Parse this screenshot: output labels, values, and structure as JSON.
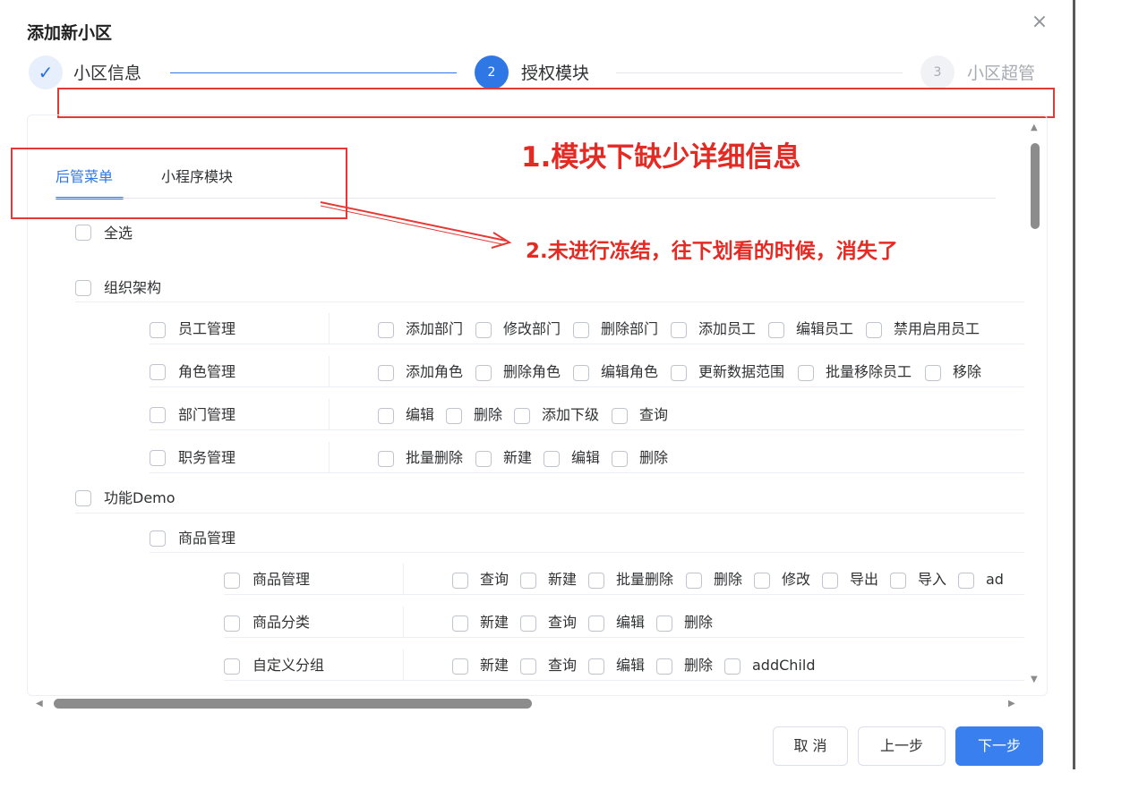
{
  "dialog": {
    "title": "添加新小区",
    "close_icon": "×"
  },
  "steps": [
    {
      "index": "✓",
      "label": "小区信息",
      "status": "finished"
    },
    {
      "index": "2",
      "label": "授权模块",
      "status": "active"
    },
    {
      "index": "3",
      "label": "小区超管",
      "status": "wait"
    }
  ],
  "annotations": {
    "note1": "1.模块下缺少详细信息",
    "note2": "2.未进行冻结，往下划看的时候，消失了"
  },
  "tabs": [
    {
      "label": "后管菜单",
      "active": true
    },
    {
      "label": "小程序模块",
      "active": false
    }
  ],
  "tree": {
    "select_all": "全选",
    "org": {
      "label": "组织架构",
      "rows": [
        {
          "name": "员工管理",
          "actions": [
            "添加部门",
            "修改部门",
            "删除部门",
            "添加员工",
            "编辑员工",
            "禁用启用员工"
          ]
        },
        {
          "name": "角色管理",
          "actions": [
            "添加角色",
            "删除角色",
            "编辑角色",
            "更新数据范围",
            "批量移除员工",
            "移除"
          ]
        },
        {
          "name": "部门管理",
          "actions": [
            "编辑",
            "删除",
            "添加下级",
            "查询"
          ]
        },
        {
          "name": "职务管理",
          "actions": [
            "批量删除",
            "新建",
            "编辑",
            "删除"
          ]
        }
      ]
    },
    "demo": {
      "label": "功能Demo",
      "sub": {
        "label": "商品管理",
        "rows": [
          {
            "name": "商品管理",
            "actions": [
              "查询",
              "新建",
              "批量删除",
              "删除",
              "修改",
              "导出",
              "导入",
              "ad"
            ]
          },
          {
            "name": "商品分类",
            "actions": [
              "新建",
              "查询",
              "编辑",
              "删除"
            ]
          },
          {
            "name": "自定义分组",
            "actions": [
              "新建",
              "查询",
              "编辑",
              "删除",
              "addChild"
            ]
          }
        ]
      }
    }
  },
  "buttons": {
    "cancel": "取 消",
    "prev": "上一步",
    "next": "下一步"
  },
  "colors": {
    "primary": "#2e77e5",
    "annotation_red": "#e32b24"
  }
}
